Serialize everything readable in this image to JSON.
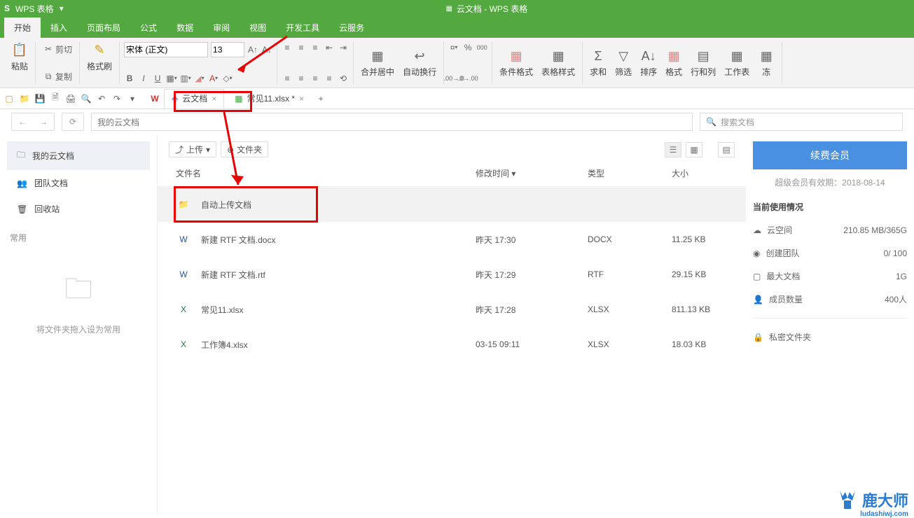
{
  "app": {
    "name": "WPS 表格",
    "doc_title": "云文档 - WPS 表格"
  },
  "menu": {
    "tabs": [
      "开始",
      "插入",
      "页面布局",
      "公式",
      "数据",
      "审阅",
      "视图",
      "开发工具",
      "云服务"
    ],
    "active": 0
  },
  "ribbon": {
    "paste": "粘贴",
    "cut": "剪切",
    "copy": "复制",
    "format_painter": "格式刷",
    "font_name": "宋体 (正文)",
    "font_size": "13",
    "merge_center": "合并居中",
    "wrap_text": "自动换行",
    "cond_fmt": "条件格式",
    "table_style": "表格样式",
    "sum": "求和",
    "filter": "筛选",
    "sort": "排序",
    "format": "格式",
    "rowcol": "行和列",
    "worksheet": "工作表",
    "freeze": "冻"
  },
  "doctabs": {
    "cloud": "云文档",
    "file2": "常见11.xlsx *"
  },
  "cloudnav": {
    "path": "我的云文档",
    "search_placeholder": "搜索文档"
  },
  "sidebar": {
    "items": [
      {
        "label": "我的云文档"
      },
      {
        "label": "团队文档"
      },
      {
        "label": "回收站"
      }
    ],
    "common_label": "常用",
    "dropzone_hint": "将文件夹拖入设为常用"
  },
  "toolbar": {
    "upload": "上传",
    "new_folder": "文件夹"
  },
  "columns": {
    "name": "文件名",
    "modified": "修改时间",
    "type": "类型",
    "size": "大小"
  },
  "files": [
    {
      "name": "自动上传文档",
      "modified": "",
      "type": "",
      "size": "",
      "icon": "folder",
      "highlight": true
    },
    {
      "name": "新建 RTF 文档.docx",
      "modified": "昨天 17:30",
      "type": "DOCX",
      "size": "11.25 KB",
      "icon": "docx"
    },
    {
      "name": "新建 RTF 文档.rtf",
      "modified": "昨天 17:29",
      "type": "RTF",
      "size": "29.15 KB",
      "icon": "rtf"
    },
    {
      "name": "常见11.xlsx",
      "modified": "昨天 17:28",
      "type": "XLSX",
      "size": "811.13 KB",
      "icon": "xlsx"
    },
    {
      "name": "工作簿4.xlsx",
      "modified": "03-15 09:11",
      "type": "XLSX",
      "size": "18.03 KB",
      "icon": "xlsx"
    }
  ],
  "rightpanel": {
    "renew": "续费会员",
    "expiry": "超级会员有效期：2018-08-14",
    "usage_title": "当前使用情况",
    "rows": [
      {
        "label": "云空间",
        "value": "210.85 MB/365G"
      },
      {
        "label": "创建团队",
        "value": "0/ 100"
      },
      {
        "label": "最大文档",
        "value": "1G"
      },
      {
        "label": "成员数量",
        "value": "400人"
      }
    ],
    "private": "私密文件夹"
  },
  "watermark": {
    "brand": "鹿大师",
    "url": "ludashiwj.com"
  }
}
